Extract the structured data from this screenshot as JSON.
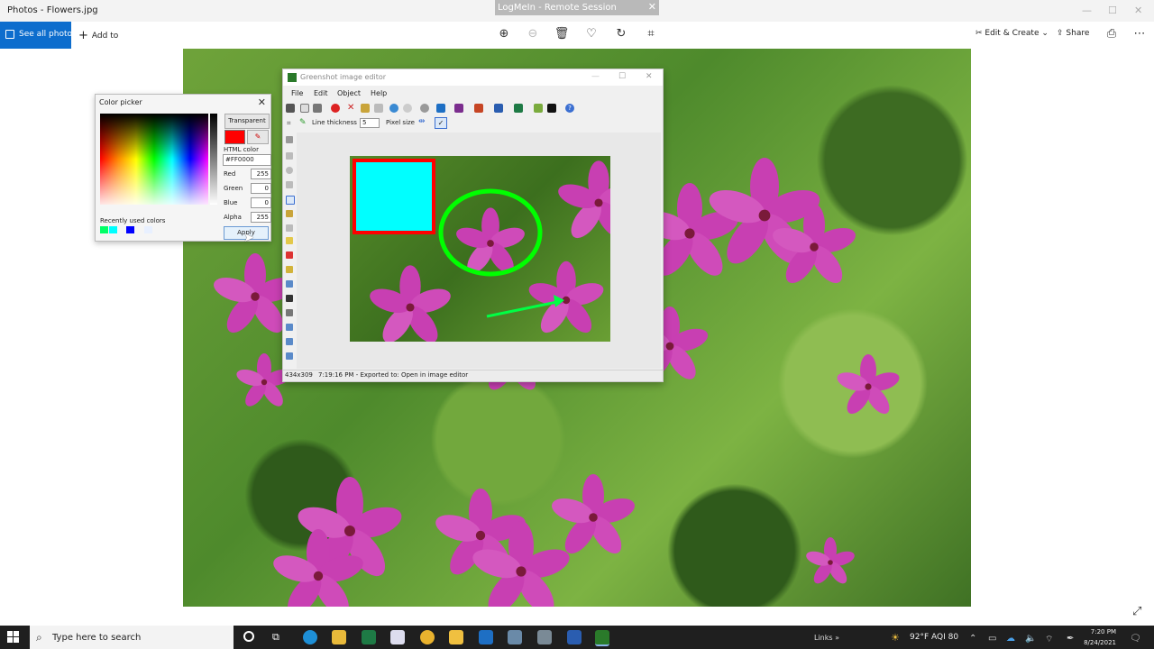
{
  "photos": {
    "title": "Photos - Flowers.jpg",
    "see_all_label": "See all photos",
    "add_to_label": "Add to",
    "edit_create_label": "Edit & Create",
    "share_label": "Share"
  },
  "remote": {
    "title": "LogMeIn - Remote Session"
  },
  "color_picker": {
    "title": "Color picker",
    "transparent_label": "Transparent",
    "html_color_label": "HTML color",
    "html_color_value": "#FF0000",
    "red_label": "Red",
    "red_value": "255",
    "green_label": "Green",
    "green_value": "0",
    "blue_label": "Blue",
    "blue_value": "0",
    "alpha_label": "Alpha",
    "alpha_value": "255",
    "recent_label": "Recently used colors",
    "recent_colors": [
      "#00ff66",
      "#00ffff",
      "#0000ff",
      "#e8f0ff"
    ],
    "apply_label": "Apply",
    "selected_color": "#ff0000"
  },
  "editor": {
    "title": "Greenshot image editor",
    "menus": [
      "File",
      "Edit",
      "Object",
      "Help"
    ],
    "line_thickness_label": "Line thickness",
    "line_thickness_value": "5",
    "pixel_size_label": "Pixel size",
    "status_size": "434x309",
    "status_message": "7:19:16 PM - Exported to: Open in image editor",
    "annotation_colors": {
      "rectangle_fill": "#00ffff",
      "rectangle_border": "#ff0000",
      "ellipse": "#00ff00",
      "arrow": "#00ff44"
    }
  },
  "taskbar": {
    "search_placeholder": "Type here to search",
    "links_label": "Links",
    "weather": "92°F  AQI 80",
    "time": "7:20 PM",
    "date": "8/24/2021"
  }
}
